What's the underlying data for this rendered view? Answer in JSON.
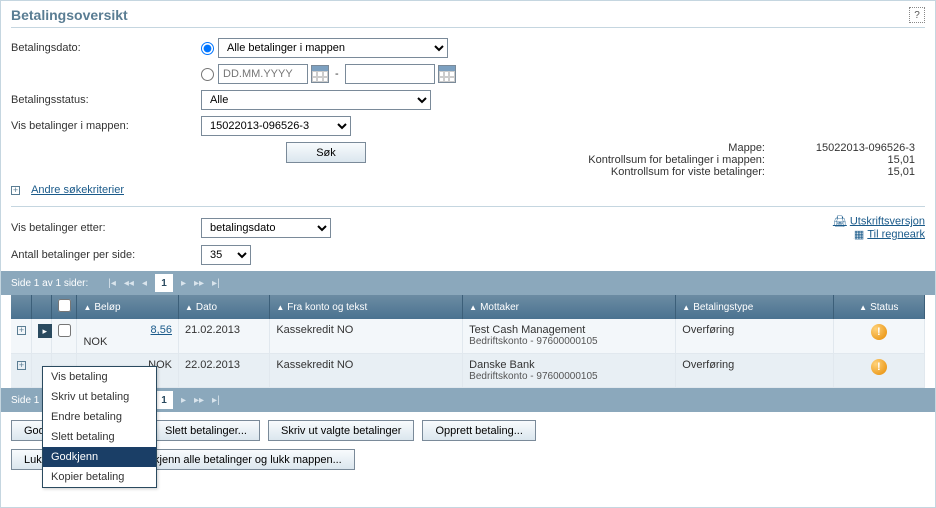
{
  "header": {
    "title": "Betalingsoversikt"
  },
  "filters": {
    "dato_label": "Betalingsdato:",
    "all_option": "Alle betalinger i mappen",
    "date_placeholder": "DD.MM.YYYY",
    "date_sep": "-",
    "status_label": "Betalingsstatus:",
    "status_value": "Alle",
    "folder_label": "Vis betalinger i mappen:",
    "folder_value": "15022013-096526-3",
    "search_btn": "Søk",
    "more_link": "Andre søkekriterier"
  },
  "summary": {
    "folder_lbl": "Mappe:",
    "folder_val": "15022013-096526-3",
    "ctrl_lbl": "Kontrollsum for betalinger i mappen:",
    "ctrl_val": "15,01",
    "shown_lbl": "Kontrollsum for viste betalinger:",
    "shown_val": "15,01"
  },
  "sort": {
    "sort_label": "Vis betalinger etter:",
    "sort_value": "betalingsdato",
    "perpage_label": "Antall betalinger per side:",
    "perpage_value": "35",
    "print_link": "Utskriftsversjon",
    "excel_link": "Til regneark"
  },
  "pager": {
    "label_top": "Side 1 av 1 sider:",
    "label_bottom": "Side 1 av 1 sider:",
    "current": "1"
  },
  "columns": {
    "amount": "Beløp",
    "date": "Dato",
    "from": "Fra konto og tekst",
    "recipient": "Mottaker",
    "type": "Betalingstype",
    "status": "Status"
  },
  "rows": [
    {
      "amount": "8,56",
      "currency": "NOK",
      "date": "21.02.2013",
      "from": "Kassekredit NO",
      "recipient_name": "Test Cash Management",
      "recipient_acc": "Bedriftskonto - 97600000105",
      "type": "Overføring"
    },
    {
      "amount": "",
      "currency": "NOK",
      "date": "22.02.2013",
      "from": "Kassekredit NO",
      "recipient_name": "Danske Bank",
      "recipient_acc": "Bedriftskonto - 97600000105",
      "type": "Overføring"
    }
  ],
  "context_menu": {
    "items": [
      "Vis betaling",
      "Skriv ut betaling",
      "Endre betaling",
      "Slett betaling",
      "Godkjenn",
      "Kopier betaling"
    ],
    "selected_index": 4
  },
  "buttons": {
    "approve": "Godkjenn betalinger...",
    "del": "Slett betalinger...",
    "print_sel": "Skriv ut valgte betalinger",
    "create": "Opprett betaling...",
    "close_folder": "Lukk mappen...",
    "approve_close": "Godkjenn alle betalinger og lukk mappen..."
  }
}
